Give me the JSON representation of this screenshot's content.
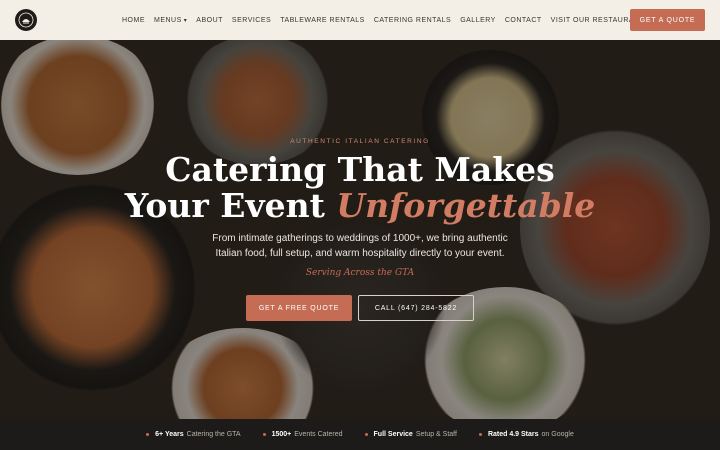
{
  "header": {
    "logo_icon": "restaurant-logo-icon",
    "nav": [
      {
        "label": "HOME"
      },
      {
        "label": "MENUS",
        "has_caret": true
      },
      {
        "label": "ABOUT"
      },
      {
        "label": "SERVICES"
      },
      {
        "label": "TABLEWARE RENTALS"
      },
      {
        "label": "CATERING RENTALS"
      },
      {
        "label": "GALLERY"
      },
      {
        "label": "CONTACT"
      },
      {
        "label": "VISIT OUR RESTAURANT"
      }
    ],
    "cta_label": "GET A QUOTE",
    "caret": "▾"
  },
  "hero": {
    "eyebrow": "AUTHENTIC ITALIAN CATERING",
    "headline_line1": "Catering That Makes",
    "headline_line2_prefix": "Your Event ",
    "headline_line2_accent": "Unforgettable",
    "subtext": "From intimate gatherings to weddings of 1000+, we bring authentic Italian food, full setup, and warm hospitality directly to your event.",
    "serving": "Serving Across the GTA",
    "primary_button": "GET A FREE QUOTE",
    "secondary_button": "CALL (647) 284-5822"
  },
  "stats": [
    {
      "bold": "6+ Years",
      "rest": "Catering the GTA"
    },
    {
      "bold": "1500+",
      "rest": "Events Catered"
    },
    {
      "bold": "Full Service",
      "rest": "Setup & Staff"
    },
    {
      "bold": "Rated 4.9 Stars",
      "rest": "on Google"
    }
  ],
  "colors": {
    "accent": "#c56c55",
    "header_bg": "#f3eee6",
    "stats_bg": "#1d1b19"
  }
}
